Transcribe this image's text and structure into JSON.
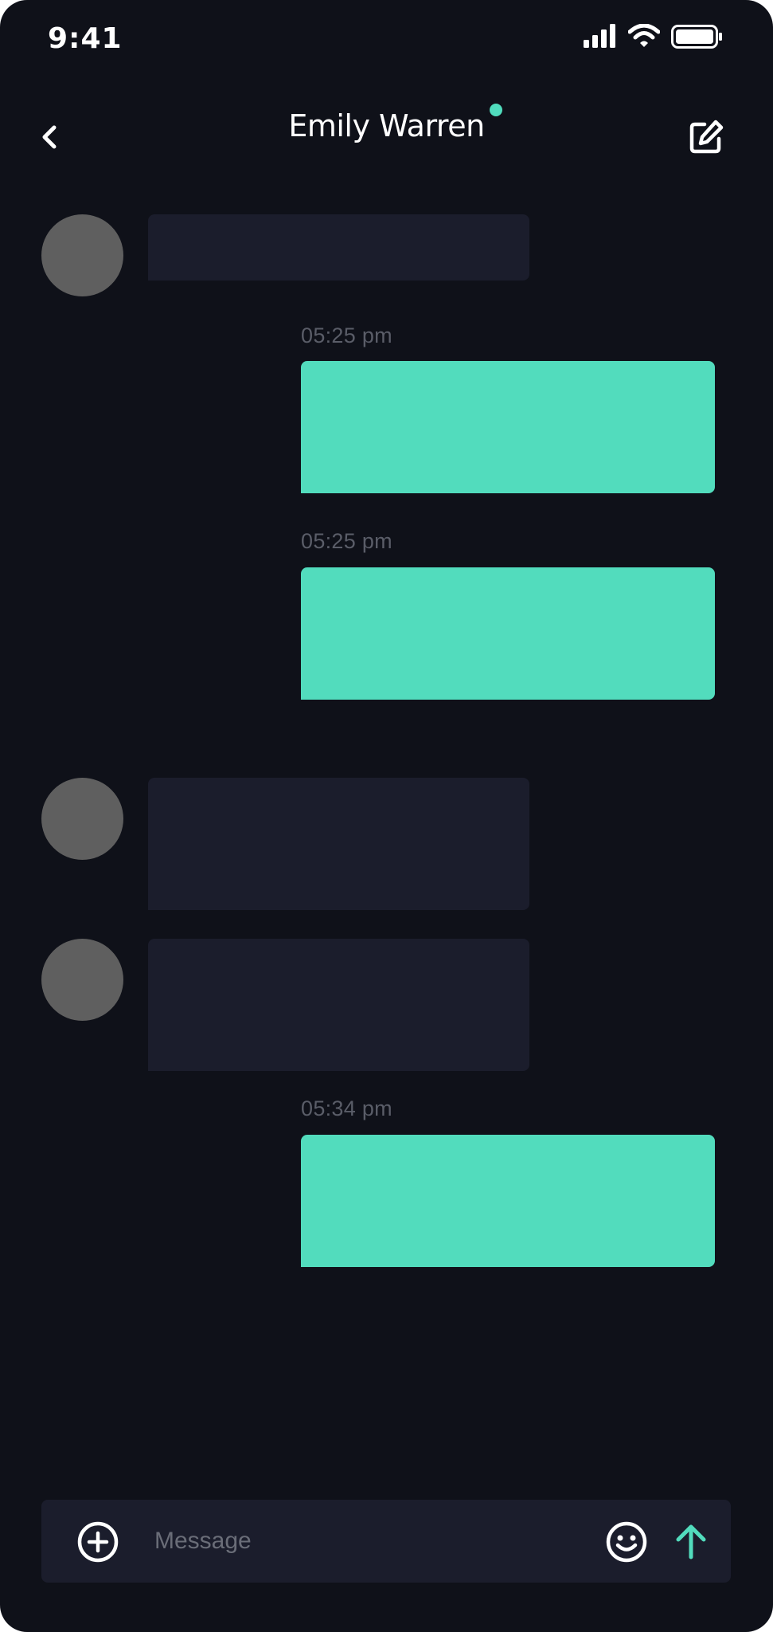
{
  "status_bar": {
    "time": "9:41"
  },
  "header": {
    "contact_name": "Emily Warren",
    "online_color": "#50dcbd"
  },
  "messages": [
    {
      "direction": "incoming",
      "timestamp": ""
    },
    {
      "direction": "outgoing",
      "timestamp": "05:25 pm"
    },
    {
      "direction": "outgoing",
      "timestamp": "05:25 pm"
    },
    {
      "direction": "incoming",
      "timestamp": ""
    },
    {
      "direction": "incoming",
      "timestamp": ""
    },
    {
      "direction": "outgoing",
      "timestamp": "05:34 pm"
    }
  ],
  "composer": {
    "placeholder": "Message",
    "value": ""
  },
  "icons": {
    "back": "chevron-left-icon",
    "edit": "compose-icon",
    "add": "plus-circle-icon",
    "emoji": "smiley-icon",
    "send": "arrow-up-icon"
  },
  "colors": {
    "background": "#0f1119",
    "accent": "#52dcbd",
    "incoming_bubble": "#1b1d2c",
    "avatar_placeholder": "#5f5f5f"
  }
}
